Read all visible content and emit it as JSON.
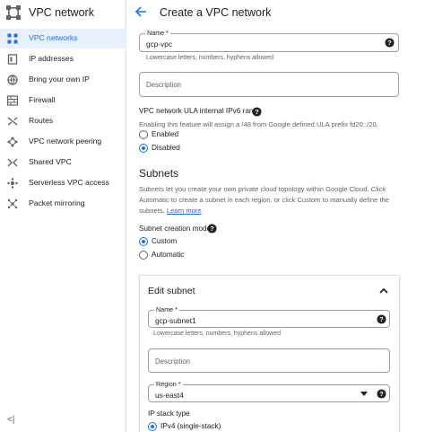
{
  "sidebar": {
    "title": "VPC network",
    "logo_icon": "vpc-network-icon",
    "items": [
      {
        "label": "VPC networks",
        "icon": "vpc-networks-icon",
        "active": true
      },
      {
        "label": "IP addresses",
        "icon": "ip-addresses-icon",
        "active": false
      },
      {
        "label": "Bring your own IP",
        "icon": "byoip-icon",
        "active": false
      },
      {
        "label": "Firewall",
        "icon": "firewall-icon",
        "active": false
      },
      {
        "label": "Routes",
        "icon": "routes-icon",
        "active": false
      },
      {
        "label": "VPC network peering",
        "icon": "peering-icon",
        "active": false
      },
      {
        "label": "Shared VPC",
        "icon": "shared-vpc-icon",
        "active": false
      },
      {
        "label": "Serverless VPC access",
        "icon": "serverless-icon",
        "active": false
      },
      {
        "label": "Packet mirroring",
        "icon": "packet-mirroring-icon",
        "active": false
      }
    ],
    "collapse_label": "<|"
  },
  "header": {
    "title": "Create a VPC network"
  },
  "form": {
    "name_label": "Name *",
    "name_value": "gcp-vpc",
    "name_hint": "Lowercase letters, numbers, hyphens allowed",
    "description_placeholder": "Description",
    "ula_label": "VPC network ULA internal IPv6 range",
    "ula_text": "Enabling this feature will assign a /48 from Google defined ULA prefix fd20::/20.",
    "ula_options": [
      "Enabled",
      "Disabled"
    ],
    "ula_selected": "Disabled"
  },
  "subnets": {
    "heading": "Subnets",
    "text_1": "Subnets let you create your own private cloud topology within Google Cloud. Click",
    "text_2": "Automatic to create a subnet in each region, or click Custom to manually define the",
    "text_3": "subnets.",
    "learn_more": "Learn more",
    "mode_label": "Subnet creation mode",
    "mode_options": [
      "Custom",
      "Automatic"
    ],
    "mode_selected": "Custom"
  },
  "edit_subnet": {
    "title": "Edit subnet",
    "name_label": "Name *",
    "name_value": "gcp-subnet1",
    "name_hint": "Lowercase letters, numbers, hyphens allowed",
    "description_placeholder": "Description",
    "region_label": "Region *",
    "region_value": "us-east4",
    "ip_stack_label": "IP stack type",
    "ip_stack_option": "IPv4 (single-stack)"
  },
  "colors": {
    "accent": "#1a73e8",
    "active_bg": "#e8f0fe",
    "text": "#202124",
    "muted": "#5f6368"
  }
}
